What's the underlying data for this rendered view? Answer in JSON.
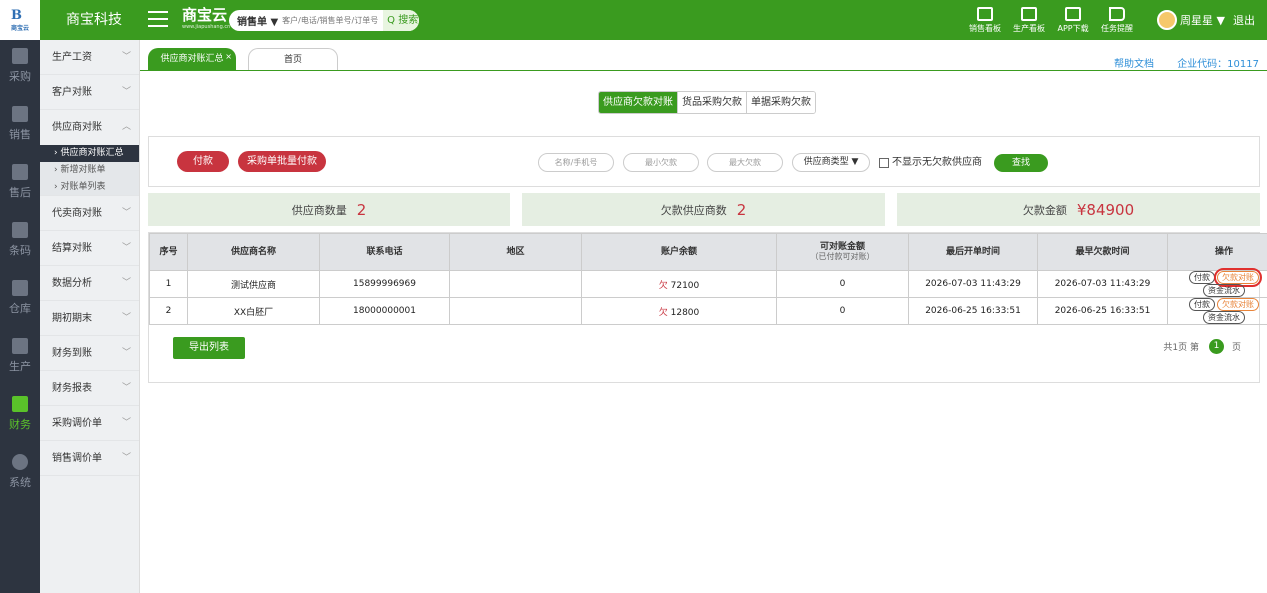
{
  "app": {
    "logo_text": "B",
    "logo_sub": "商宝云",
    "company": "商宝科技",
    "brand": "商宝云",
    "brand_sub": "www.jiapushang.cn"
  },
  "search": {
    "selector": "销售单 ▼",
    "placeholder": "客户/电话/销售单号/订单号",
    "button": "Q 搜索"
  },
  "top_tools": [
    {
      "label": "销售看板",
      "icon": "chart-board-icon"
    },
    {
      "label": "生产看板",
      "icon": "production-board-icon"
    },
    {
      "label": "APP下载",
      "icon": "qrcode-icon"
    },
    {
      "label": "任务提醒",
      "icon": "flag-icon"
    }
  ],
  "user": {
    "name": "周星星 ▼",
    "logout": "退出"
  },
  "iconbar": [
    {
      "label": "采购",
      "icon": "cart-icon",
      "active": false
    },
    {
      "label": "销售",
      "icon": "sales-icon",
      "active": false
    },
    {
      "label": "售后",
      "icon": "aftersale-icon",
      "active": false
    },
    {
      "label": "条码",
      "icon": "barcode-icon",
      "active": false
    },
    {
      "label": "仓库",
      "icon": "warehouse-icon",
      "active": false
    },
    {
      "label": "生产",
      "icon": "production-icon",
      "active": false
    },
    {
      "label": "财务",
      "icon": "calculator-icon",
      "active": true
    },
    {
      "label": "系统",
      "icon": "gear-icon",
      "active": false
    }
  ],
  "submenu": [
    {
      "label": "生产工资",
      "chev": "﹀"
    },
    {
      "label": "客户对账",
      "chev": "﹀"
    },
    {
      "label": "供应商对账",
      "chev": "︿"
    },
    {
      "label": "代卖商对账",
      "chev": "﹀"
    },
    {
      "label": "结算对账",
      "chev": "﹀"
    },
    {
      "label": "数据分析",
      "chev": "﹀"
    },
    {
      "label": "期初期末",
      "chev": "﹀"
    },
    {
      "label": "财务到账",
      "chev": "﹀"
    },
    {
      "label": "财务报表",
      "chev": "﹀"
    },
    {
      "label": "采购调价单",
      "chev": "﹀"
    },
    {
      "label": "销售调价单",
      "chev": "﹀"
    }
  ],
  "submenu_children": [
    {
      "label": "› 供应商对账汇总",
      "active": true
    },
    {
      "label": "› 新增对账单",
      "active": false
    },
    {
      "label": "› 对账单列表",
      "active": false
    }
  ],
  "tabs": {
    "active": "供应商对账汇总",
    "home": "首页",
    "close": "×"
  },
  "toplinks": {
    "help": "帮助文档",
    "company_code": "企业代码：10117"
  },
  "segmented": [
    "供应商欠款对账",
    "货品采购欠款",
    "单据采购欠款"
  ],
  "filter": {
    "pay_btn": "付款",
    "batch_pay_btn": "采购单批量付款",
    "name_placeholder": "名称/手机号",
    "min_placeholder": "最小欠款",
    "max_placeholder": "最大欠款",
    "type_select": "供应商类型 ▼",
    "hide_zero": "不显示无欠款供应商",
    "search_btn": "查找"
  },
  "summary": {
    "supplier_count_label": "供应商数量",
    "supplier_count": "2",
    "owing_count_label": "欠款供应商数",
    "owing_count": "2",
    "owing_amount_label": "欠款金额",
    "owing_amount": "¥84900"
  },
  "table": {
    "headers": [
      "序号",
      "供应商名称",
      "联系电话",
      "地区",
      "账户余额",
      "可对账金额",
      "最后开单时间",
      "最早欠款时间",
      "操作"
    ],
    "header_note": "（已付款可对账）",
    "rows": [
      {
        "no": "1",
        "name": "测试供应商",
        "phone": "15899996969",
        "region": "",
        "owe_prefix": "欠",
        "balance": "72100",
        "reconcilable": "0",
        "last_order": "2026-07-03 11:43:29",
        "earliest_owe": "2026-07-03 11:43:29"
      },
      {
        "no": "2",
        "name": "XX白胚厂",
        "phone": "18000000001",
        "region": "",
        "owe_prefix": "欠",
        "balance": "12800",
        "reconcilable": "0",
        "last_order": "2026-06-25 16:33:51",
        "earliest_owe": "2026-06-25 16:33:51"
      }
    ],
    "ops": {
      "pay": "付款",
      "reconcile": "欠款对账",
      "flow": "资金流水"
    }
  },
  "export_btn": "导出列表",
  "pager": {
    "total": "共1页",
    "goto": "第",
    "page": "1",
    "unit": "页"
  }
}
